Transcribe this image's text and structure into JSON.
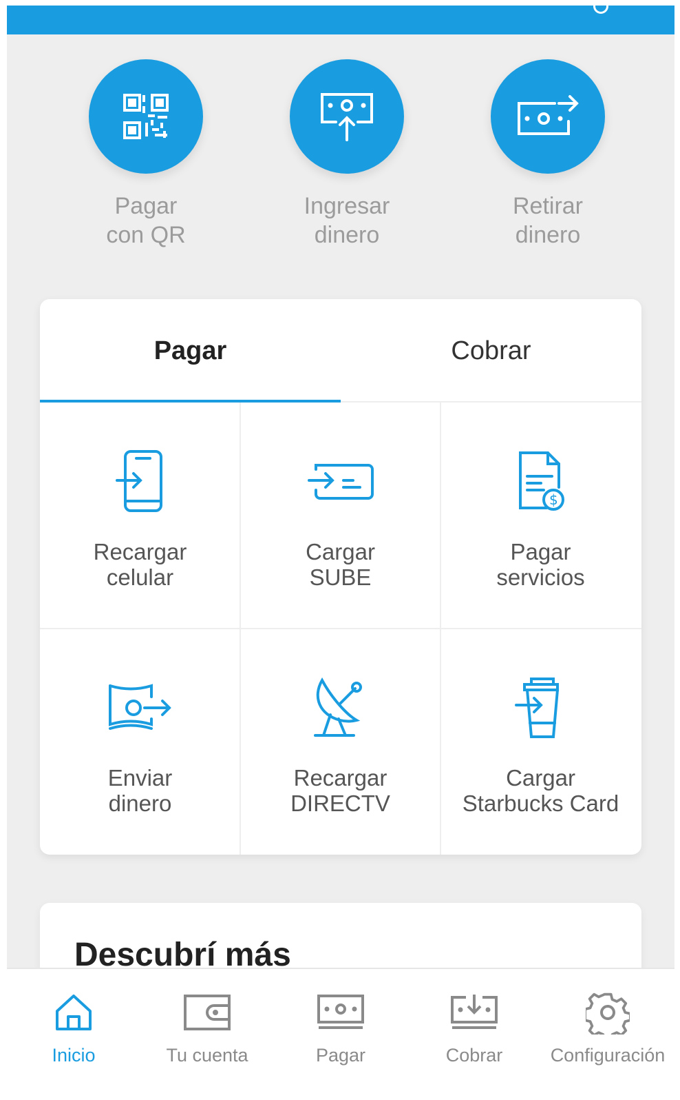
{
  "colors": {
    "accent": "#1a9de0",
    "background": "#eeeeee",
    "label_gray": "#9b9b9b"
  },
  "quick_actions": [
    {
      "label_line1": "Pagar",
      "label_line2": "con QR",
      "icon": "qr-code-icon"
    },
    {
      "label_line1": "Ingresar",
      "label_line2": "dinero",
      "icon": "deposit-money-icon"
    },
    {
      "label_line1": "Retirar",
      "label_line2": "dinero",
      "icon": "withdraw-money-icon"
    }
  ],
  "tabs": [
    {
      "label": "Pagar",
      "active": true
    },
    {
      "label": "Cobrar",
      "active": false
    }
  ],
  "services": [
    {
      "line1": "Recargar",
      "line2": "celular",
      "icon": "phone-recharge-icon"
    },
    {
      "line1": "Cargar",
      "line2": "SUBE",
      "icon": "transport-card-icon"
    },
    {
      "line1": "Pagar",
      "line2": "servicios",
      "icon": "bill-payment-icon"
    },
    {
      "line1": "Enviar",
      "line2": "dinero",
      "icon": "send-money-icon"
    },
    {
      "line1": "Recargar",
      "line2": "DIRECTV",
      "icon": "satellite-dish-icon"
    },
    {
      "line1": "Cargar",
      "line2": "Starbucks Card",
      "icon": "coffee-cup-icon"
    }
  ],
  "discover": {
    "title": "Descubrí más"
  },
  "nav": [
    {
      "label": "Inicio",
      "icon": "home-icon",
      "active": true
    },
    {
      "label": "Tu cuenta",
      "icon": "wallet-icon",
      "active": false
    },
    {
      "label": "Pagar",
      "icon": "bill-icon",
      "active": false
    },
    {
      "label": "Cobrar",
      "icon": "receive-money-icon",
      "active": false
    },
    {
      "label": "Configuración",
      "icon": "gear-icon",
      "active": false
    }
  ]
}
